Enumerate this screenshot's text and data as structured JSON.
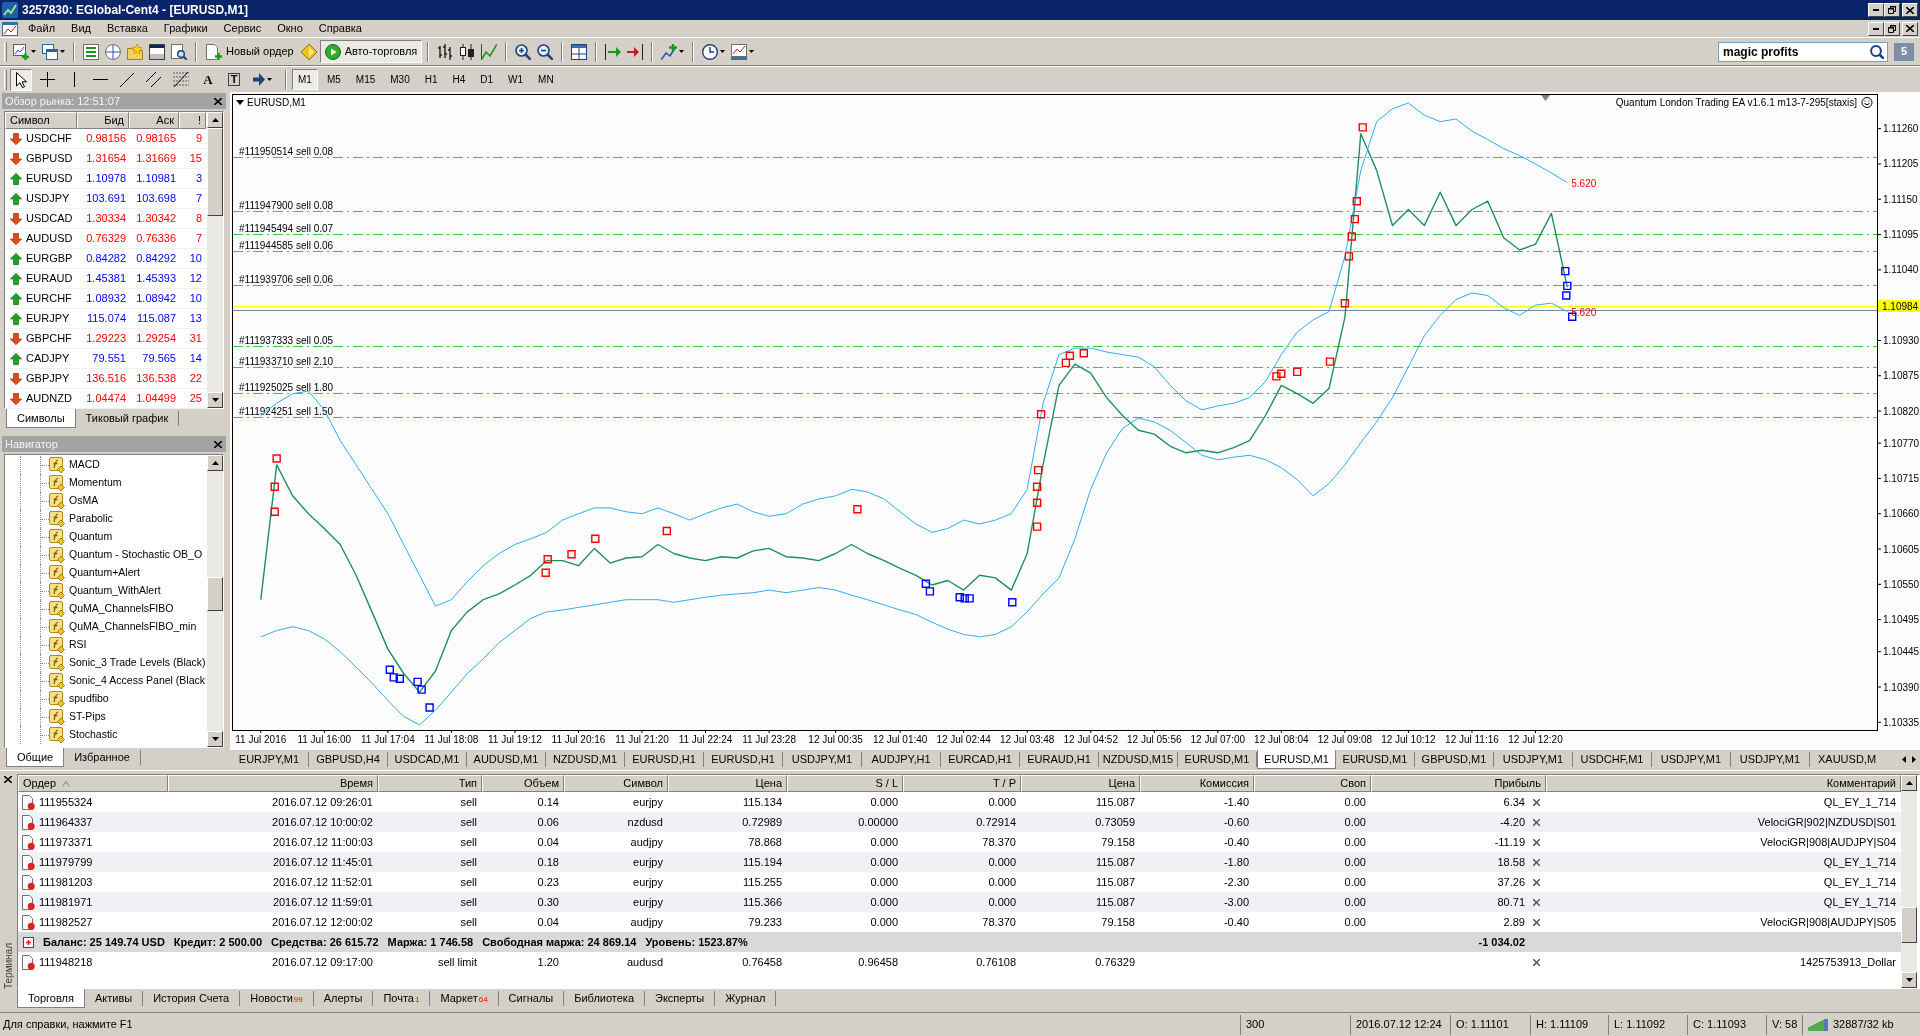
{
  "window": {
    "title": "3257830: EGlobal-Cent4 - [EURUSD,M1]"
  },
  "menu": [
    "Файл",
    "Вид",
    "Вставка",
    "Графики",
    "Сервис",
    "Окно",
    "Справка"
  ],
  "toolbar": {
    "new_order": "Новый ордер",
    "autotrading": {
      "label": "Авто-торговля",
      "on": true
    },
    "search": {
      "value": "magic profits"
    },
    "badge": "5"
  },
  "drawing_toolbar": {
    "tools": [
      {
        "kind": "cursor",
        "selected": true
      },
      {
        "kind": "crosshair",
        "selected": false
      },
      {
        "kind": "vertical-line",
        "selected": false
      },
      {
        "kind": "horizontal-line",
        "selected": false
      },
      {
        "kind": "trendline",
        "selected": false
      },
      {
        "kind": "channel",
        "selected": false
      },
      {
        "kind": "fibonacci",
        "selected": false
      },
      {
        "kind": "text",
        "glyph": "A",
        "selected": false
      },
      {
        "kind": "label",
        "glyph": "T",
        "selected": false
      },
      {
        "kind": "arrows",
        "selected": false
      }
    ],
    "periods": [
      {
        "label": "M1",
        "selected": true
      },
      {
        "label": "M5",
        "selected": false
      },
      {
        "label": "M15",
        "selected": false
      },
      {
        "label": "M30",
        "selected": false
      },
      {
        "label": "H1",
        "selected": false
      },
      {
        "label": "H4",
        "selected": false
      },
      {
        "label": "D1",
        "selected": false
      },
      {
        "label": "W1",
        "selected": false
      },
      {
        "label": "MN",
        "selected": false
      }
    ]
  },
  "market_watch": {
    "title": "Обзор рынка: 12:51:07",
    "columns": [
      "Символ",
      "Бид",
      "Аск",
      "!"
    ],
    "rows": [
      {
        "symbol": "USDCHF",
        "rising": false,
        "bid": "0.98156",
        "ask": "0.98165",
        "spread": "9"
      },
      {
        "symbol": "GBPUSD",
        "rising": false,
        "bid": "1.31654",
        "ask": "1.31669",
        "spread": "15"
      },
      {
        "symbol": "EURUSD",
        "rising": true,
        "bid": "1.10978",
        "ask": "1.10981",
        "spread": "3"
      },
      {
        "symbol": "USDJPY",
        "rising": true,
        "bid": "103.691",
        "ask": "103.698",
        "spread": "7"
      },
      {
        "symbol": "USDCAD",
        "rising": false,
        "bid": "1.30334",
        "ask": "1.30342",
        "spread": "8"
      },
      {
        "symbol": "AUDUSD",
        "rising": false,
        "bid": "0.76329",
        "ask": "0.76336",
        "spread": "7"
      },
      {
        "symbol": "EURGBP",
        "rising": true,
        "bid": "0.84282",
        "ask": "0.84292",
        "spread": "10"
      },
      {
        "symbol": "EURAUD",
        "rising": true,
        "bid": "1.45381",
        "ask": "1.45393",
        "spread": "12"
      },
      {
        "symbol": "EURCHF",
        "rising": true,
        "bid": "1.08932",
        "ask": "1.08942",
        "spread": "10"
      },
      {
        "symbol": "EURJPY",
        "rising": true,
        "bid": "115.074",
        "ask": "115.087",
        "spread": "13"
      },
      {
        "symbol": "GBPCHF",
        "rising": false,
        "bid": "1.29223",
        "ask": "1.29254",
        "spread": "31"
      },
      {
        "symbol": "CADJPY",
        "rising": true,
        "bid": "79.551",
        "ask": "79.565",
        "spread": "14"
      },
      {
        "symbol": "GBPJPY",
        "rising": false,
        "bid": "136.516",
        "ask": "136.538",
        "spread": "22"
      },
      {
        "symbol": "AUDNZD",
        "rising": false,
        "bid": "1.04474",
        "ask": "1.04499",
        "spread": "25"
      }
    ],
    "tabs": [
      {
        "label": "Символы",
        "selected": true
      },
      {
        "label": "Тиковый график",
        "selected": false
      }
    ]
  },
  "navigator": {
    "title": "Навигатор",
    "items": [
      "MACD",
      "Momentum",
      "OsMA",
      "Parabolic",
      "Quantum",
      "Quantum - Stochastic OB_O",
      "Quantum+Alert",
      "Quantum_WithAlert",
      "QuMA_ChannelsFIBO",
      "QuMA_ChannelsFIBO_min",
      "RSI",
      "Sonic_3 Trade Levels (Black)",
      "Sonic_4 Access Panel (Black",
      "spudfibo",
      "ST-Pips",
      "Stochastic"
    ],
    "tabs": [
      {
        "label": "Общие",
        "selected": true
      },
      {
        "label": "Избранное",
        "selected": false
      }
    ]
  },
  "chart": {
    "symbol_label": "EURUSD,M1",
    "expert_label": "Quantum London Trading EA v1.6.1 m13-7-295[staxis]",
    "chart_data": [
      {
        "type": "line",
        "x": [
          "2016-07-11T14:56",
          "2016-07-11T15:12",
          "2016-07-11T15:28",
          "2016-07-11T15:44",
          "2016-07-11T16:00",
          "2016-07-11T16:16",
          "2016-07-11T16:32",
          "2016-07-11T16:48",
          "2016-07-11T17:04",
          "2016-07-11T17:20",
          "2016-07-11T17:36",
          "2016-07-11T17:52",
          "2016-07-11T18:08",
          "2016-07-11T18:24",
          "2016-07-11T18:40",
          "2016-07-11T18:56",
          "2016-07-11T19:12",
          "2016-07-11T19:28",
          "2016-07-11T19:44",
          "2016-07-11T20:00",
          "2016-07-11T20:16",
          "2016-07-11T20:32",
          "2016-07-11T20:48",
          "2016-07-11T21:04",
          "2016-07-11T21:20",
          "2016-07-11T21:36",
          "2016-07-11T21:52",
          "2016-07-11T22:08",
          "2016-07-11T22:24",
          "2016-07-11T22:40",
          "2016-07-11T22:56",
          "2016-07-11T23:12",
          "2016-07-11T23:28",
          "2016-07-11T23:45",
          "2016-07-12T00:02",
          "2016-07-12T00:18",
          "2016-07-12T00:35",
          "2016-07-12T00:51",
          "2016-07-12T01:07",
          "2016-07-12T01:24",
          "2016-07-12T01:40",
          "2016-07-12T01:56",
          "2016-07-12T02:12",
          "2016-07-12T02:28",
          "2016-07-12T02:44",
          "2016-07-12T03:00",
          "2016-07-12T03:16",
          "2016-07-12T03:32",
          "2016-07-12T03:48",
          "2016-07-12T04:04",
          "2016-07-12T04:20",
          "2016-07-12T04:36",
          "2016-07-12T04:52",
          "2016-07-12T05:08",
          "2016-07-12T05:24",
          "2016-07-12T05:40",
          "2016-07-12T05:56",
          "2016-07-12T06:12",
          "2016-07-12T06:28",
          "2016-07-12T06:44",
          "2016-07-12T07:00",
          "2016-07-12T07:16",
          "2016-07-12T07:32",
          "2016-07-12T07:48",
          "2016-07-12T08:04",
          "2016-07-12T08:20",
          "2016-07-12T08:36",
          "2016-07-12T08:52",
          "2016-07-12T09:08",
          "2016-07-12T09:24",
          "2016-07-12T09:40",
          "2016-07-12T09:56",
          "2016-07-12T10:12",
          "2016-07-12T10:28",
          "2016-07-12T10:44",
          "2016-07-12T11:00",
          "2016-07-12T11:16",
          "2016-07-12T11:32",
          "2016-07-12T11:48",
          "2016-07-12T12:04",
          "2016-07-12T12:20",
          "2016-07-12T12:36",
          "2016-07-12T12:52"
        ],
        "xlim": [
          "2016-07-11T14:27",
          "2016-07-12T18:04"
        ],
        "ylim": [
          1.10323,
          1.11314
        ],
        "xticks": [
          {
            "value": "2016-07-11T16:00",
            "label": "11 Jul 16:00"
          },
          {
            "value": "2016-07-11T17:04",
            "label": "11 Jul 17:04"
          },
          {
            "value": "2016-07-11T18:08",
            "label": "11 Jul 18:08"
          },
          {
            "value": "2016-07-11T19:12",
            "label": "11 Jul 19:12"
          },
          {
            "value": "2016-07-11T20:16",
            "label": "11 Jul 20:16"
          },
          {
            "value": "2016-07-11T21:20",
            "label": "11 Jul 21:20"
          },
          {
            "value": "2016-07-11T22:24",
            "label": "11 Jul 22:24"
          },
          {
            "value": "2016-07-11T23:28",
            "label": "11 Jul 23:28"
          },
          {
            "value": "2016-07-12T00:35",
            "label": "12 Jul 00:35"
          },
          {
            "value": "2016-07-12T01:40",
            "label": "12 Jul 01:40"
          },
          {
            "value": "2016-07-12T02:44",
            "label": "12 Jul 02:44"
          },
          {
            "value": "2016-07-12T03:48",
            "label": "12 Jul 03:48"
          },
          {
            "value": "2016-07-12T04:52",
            "label": "12 Jul 04:52"
          },
          {
            "value": "2016-07-12T05:56",
            "label": "12 Jul 05:56"
          },
          {
            "value": "2016-07-12T07:00",
            "label": "12 Jul 07:00"
          },
          {
            "value": "2016-07-12T08:04",
            "label": "12 Jul 08:04"
          },
          {
            "value": "2016-07-12T09:08",
            "label": "12 Jul 09:08"
          },
          {
            "value": "2016-07-12T10:12",
            "label": "12 Jul 10:12"
          },
          {
            "value": "2016-07-12T11:16",
            "label": "12 Jul 11:16"
          },
          {
            "value": "2016-07-12T12:20",
            "label": "12 Jul 12:20"
          }
        ],
        "annotations": [
          "11 Jul 2016"
        ],
        "yticks": [
          {
            "value": 1.1126,
            "label": "1.11260"
          },
          {
            "value": 1.11205,
            "label": "1.11205"
          },
          {
            "value": 1.1115,
            "label": "1.11150"
          },
          {
            "value": 1.11095,
            "label": "1.11095"
          },
          {
            "value": 1.1104,
            "label": "1.11040"
          },
          {
            "value": 1.1093,
            "label": "1.10930"
          },
          {
            "value": 1.10875,
            "label": "1.10875"
          },
          {
            "value": 1.1082,
            "label": "1.10820"
          },
          {
            "value": 1.1077,
            "label": "1.10770"
          },
          {
            "value": 1.10715,
            "label": "1.10715"
          },
          {
            "value": 1.1066,
            "label": "1.10660"
          },
          {
            "value": 1.10605,
            "label": "1.10605"
          },
          {
            "value": 1.1055,
            "label": "1.10550"
          },
          {
            "value": 1.10495,
            "label": "1.10495"
          },
          {
            "value": 1.10445,
            "label": "1.10445"
          },
          {
            "value": 1.1039,
            "label": "1.10390"
          },
          {
            "value": 1.10335,
            "label": "1.10335"
          }
        ],
        "series": [
          {
            "color": "#1f8f5f",
            "values": [
              1.10526,
              1.10736,
              1.10688,
              1.1066,
              1.10637,
              1.10612,
              1.10564,
              1.10507,
              1.10449,
              1.10411,
              1.10382,
              1.10415,
              1.10478,
              1.10507,
              1.10526,
              1.10535,
              1.10549,
              1.10564,
              1.10587,
              1.10587,
              1.10579,
              1.10606,
              1.10583,
              1.10591,
              1.10593,
              1.10612,
              1.10598,
              1.10591,
              1.10587,
              1.10593,
              1.10591,
              1.10602,
              1.10606,
              1.10593,
              1.10591,
              1.10587,
              1.10598,
              1.10612,
              1.10598,
              1.10587,
              1.10575,
              1.10564,
              1.10549,
              1.10556,
              1.10541,
              1.10564,
              1.1056,
              1.10541,
              1.10598,
              1.10736,
              1.1086,
              1.10893,
              1.10879,
              1.10841,
              1.10813,
              1.1079,
              1.10784,
              1.10765,
              1.10755,
              1.10759,
              1.10755,
              1.10763,
              1.10774,
              1.10813,
              1.1086,
              1.10847,
              1.10832,
              1.10855,
              1.10966,
              1.11252,
              1.11195,
              1.11109,
              1.11134,
              1.11109,
              1.11161,
              1.11109,
              1.11134,
              1.11147,
              1.1109,
              1.11071,
              1.1108,
              1.11128,
              1.11013
            ]
          },
          {
            "name": "5.620",
            "color": "#30aef0",
            "values": [
              1.10813,
              1.10832,
              1.10847,
              1.10851,
              1.10822,
              1.10774,
              1.10736,
              1.10698,
              1.1066,
              1.10612,
              1.10564,
              1.10516,
              1.10526,
              1.10554,
              1.10579,
              1.10598,
              1.10612,
              1.10621,
              1.10631,
              1.1065,
              1.1066,
              1.10669,
              1.10669,
              1.10663,
              1.1066,
              1.10669,
              1.1066,
              1.1065,
              1.1066,
              1.10669,
              1.10675,
              1.10663,
              1.10656,
              1.1066,
              1.10675,
              1.10683,
              1.10688,
              1.10698,
              1.10694,
              1.10683,
              1.10663,
              1.10644,
              1.10631,
              1.10637,
              1.1065,
              1.10644,
              1.1065,
              1.1066,
              1.10698,
              1.10832,
              1.10908,
              1.10918,
              1.10918,
              1.10912,
              1.10908,
              1.10904,
              1.10889,
              1.1086,
              1.10836,
              1.10822,
              1.10828,
              1.10832,
              1.10841,
              1.10866,
              1.10908,
              1.10943,
              1.10962,
              1.10975,
              1.11061,
              1.11195,
              1.11271,
              1.11291,
              1.113,
              1.11281,
              1.11271,
              1.11275,
              1.11256,
              1.11243,
              1.11229,
              1.11218,
              1.11205,
              1.11191,
              1.11176
            ]
          },
          {
            "name": "5.620",
            "color": "#30aef0",
            "values": [
              1.10468,
              1.10478,
              1.10484,
              1.10478,
              1.10465,
              1.10445,
              1.10421,
              1.10396,
              1.10369,
              1.10344,
              1.10331,
              1.10354,
              1.10382,
              1.10411,
              1.10434,
              1.10459,
              1.10478,
              1.10497,
              1.10507,
              1.1051,
              1.10514,
              1.10518,
              1.10522,
              1.10526,
              1.10526,
              1.10526,
              1.10522,
              1.10526,
              1.1053,
              1.10533,
              1.10535,
              1.10537,
              1.10541,
              1.10537,
              1.10541,
              1.10545,
              1.10541,
              1.10533,
              1.10526,
              1.10518,
              1.1051,
              1.10503,
              1.10491,
              1.1048,
              1.10472,
              1.10468,
              1.10472,
              1.10484,
              1.10507,
              1.10535,
              1.1056,
              1.10621,
              1.10698,
              1.10755,
              1.10793,
              1.10809,
              1.10803,
              1.1079,
              1.10771,
              1.10751,
              1.10744,
              1.10748,
              1.10751,
              1.10744,
              1.10732,
              1.10713,
              1.10688,
              1.10707,
              1.10736,
              1.10771,
              1.10803,
              1.10841,
              1.10889,
              1.10937,
              1.10969,
              1.10994,
              1.11004,
              1.11,
              1.10981,
              1.10969,
              1.10985,
              1.10988,
              1.10975
            ]
          },
          {
            "type": "scatter",
            "marker": "square",
            "color": "#ff0000",
            "x": [
              "2016-07-11T15:12",
              "2016-07-11T15:10",
              "2016-07-11T15:10",
              "2016-07-11T19:45",
              "2016-07-11T19:43",
              "2016-07-11T20:09",
              "2016-07-11T20:33",
              "2016-07-11T21:45",
              "2016-07-12T00:57",
              "2016-07-12T03:58",
              "2016-07-12T03:58",
              "2016-07-12T03:58",
              "2016-07-12T03:59",
              "2016-07-12T04:02",
              "2016-07-12T04:27",
              "2016-07-12T04:31",
              "2016-07-12T04:45",
              "2016-07-12T07:59",
              "2016-07-12T08:04",
              "2016-07-12T08:20",
              "2016-07-12T08:53",
              "2016-07-12T09:08",
              "2016-07-12T09:12",
              "2016-07-12T09:15",
              "2016-07-12T09:18",
              "2016-07-12T09:20",
              "2016-07-12T09:26"
            ],
            "values": [
              1.10746,
              1.10702,
              1.10663,
              1.10589,
              1.10568,
              1.10597,
              1.10621,
              1.10633,
              1.10667,
              1.1064,
              1.10677,
              1.10702,
              1.10728,
              1.10815,
              1.10895,
              1.10906,
              1.1091,
              1.10874,
              1.10878,
              1.10881,
              1.10897,
              1.10988,
              1.11061,
              1.11092,
              1.11119,
              1.11147,
              1.11262
            ]
          },
          {
            "type": "scatter",
            "marker": "square",
            "color": "#0000ff",
            "x": [
              "2016-07-11T17:06",
              "2016-07-11T17:10",
              "2016-07-11T17:16",
              "2016-07-11T17:34",
              "2016-07-11T17:38",
              "2016-07-11T17:46",
              "2016-07-12T02:06",
              "2016-07-12T02:10",
              "2016-07-12T02:40",
              "2016-07-12T02:45",
              "2016-07-12T02:50",
              "2016-07-12T03:33",
              "2016-07-12T12:50",
              "2016-07-12T12:51",
              "2016-07-12T12:52",
              "2016-07-12T12:57"
            ],
            "values": [
              1.10417,
              1.10405,
              1.10403,
              1.10398,
              1.10386,
              1.10358,
              1.10551,
              1.10539,
              1.1053,
              1.10528,
              1.10528,
              1.10522,
              1.11038,
              1.11,
              1.11015,
              1.10967
            ]
          }
        ],
        "ref_lines": [
          {
            "axis": "y",
            "value": 1.11216,
            "label": "#111950514 sell 0.08",
            "color": "#32cd32",
            "line_style": "dashdot"
          },
          {
            "axis": "y",
            "value": 1.11132,
            "label": "#111947900 sell 0.08",
            "color": "#32cd32",
            "line_style": "dashdot"
          },
          {
            "axis": "y",
            "value": 1.11096,
            "label": "#111945494 sell 0.07",
            "color": "#32cd32",
            "line_style": "dashdot"
          },
          {
            "axis": "y",
            "value": 1.1107,
            "label": "#111944585 sell 0.06",
            "color": "#32cd32",
            "line_style": "dashdot"
          },
          {
            "axis": "y",
            "value": 1.11016,
            "label": "#111939706 sell 0.06",
            "color": "#32cd32",
            "line_style": "dashdot"
          },
          {
            "axis": "y",
            "value": 1.10984,
            "label": "1.10984",
            "color": "#ffff00",
            "line_style": "solid"
          },
          {
            "axis": "y",
            "value": 1.10978,
            "color": "#778899",
            "line_style": "solid"
          },
          {
            "axis": "y",
            "value": 1.10921,
            "label": "#111937333 sell 0.05",
            "color": "#32cd32",
            "line_style": "dashdot"
          },
          {
            "axis": "y",
            "value": 1.10889,
            "label": "#111933710 sell 2.10",
            "color": "#32cd32",
            "line_style": "dashdot"
          },
          {
            "axis": "y",
            "value": 1.10848,
            "label": "#111925025 sell 1.80",
            "color": "#32cd32",
            "line_style": "dashdot"
          },
          {
            "axis": "y",
            "value": 1.10811,
            "label": "#111924251 sell 1.50",
            "color": "#32cd32",
            "line_style": "dashdot"
          }
        ]
      }
    ]
  },
  "chart_tabs": [
    {
      "label": "EURJPY,M1",
      "selected": false
    },
    {
      "label": "GBPUSD,H4",
      "selected": false
    },
    {
      "label": "USDCAD,M1",
      "selected": false
    },
    {
      "label": "AUDUSD,M1",
      "selected": false
    },
    {
      "label": "NZDUSD,M1",
      "selected": false
    },
    {
      "label": "EURUSD,H1",
      "selected": false
    },
    {
      "label": "EURUSD,H1",
      "selected": false
    },
    {
      "label": "USDJPY,M1",
      "selected": false
    },
    {
      "label": "AUDJPY,H1",
      "selected": false
    },
    {
      "label": "EURCAD,H1",
      "selected": false
    },
    {
      "label": "EURAUD,H1",
      "selected": false
    },
    {
      "label": "NZDUSD,M15",
      "selected": false
    },
    {
      "label": "EURUSD,M1",
      "selected": false
    },
    {
      "label": "EURUSD,M1",
      "selected": true
    },
    {
      "label": "EURUSD,M1",
      "selected": false
    },
    {
      "label": "GBPUSD,M1",
      "selected": false
    },
    {
      "label": "USDJPY,M1",
      "selected": false
    },
    {
      "label": "USDCHF,M1",
      "selected": false
    },
    {
      "label": "USDJPY,M1",
      "selected": false
    },
    {
      "label": "USDJPY,M1",
      "selected": false
    },
    {
      "label": "XAUUSD,M",
      "selected": false
    }
  ],
  "terminal": {
    "side_label": "Терминал",
    "columns": [
      {
        "label": "Ордер",
        "sorted": true
      },
      {
        "label": "Время",
        "sorted": false
      },
      {
        "label": "Тип",
        "sorted": false
      },
      {
        "label": "Объем",
        "sorted": false
      },
      {
        "label": "Символ",
        "sorted": false
      },
      {
        "label": "Цена",
        "sorted": false
      },
      {
        "label": "S / L",
        "sorted": false
      },
      {
        "label": "T / P",
        "sorted": false
      },
      {
        "label": "Цена",
        "sorted": false
      },
      {
        "label": "Комиссия",
        "sorted": false
      },
      {
        "label": "Своп",
        "sorted": false
      },
      {
        "label": "Прибыль",
        "sorted": false
      },
      {
        "label": "Комментарий",
        "sorted": false
      }
    ],
    "orders": [
      {
        "order": "111955324",
        "time": "2016.07.12 09:26:01",
        "type": "sell",
        "volume": "0.14",
        "symbol": "eurjpy",
        "price": "115.134",
        "sl": "0.000",
        "tp": "0.000",
        "current_price": "115.087",
        "commission": "-1.40",
        "swap": "0.00",
        "profit": "6.34",
        "comment": "QL_EY_1_714"
      },
      {
        "order": "111964337",
        "time": "2016.07.12 10:00:02",
        "type": "sell",
        "volume": "0.06",
        "symbol": "nzdusd",
        "price": "0.72989",
        "sl": "0.00000",
        "tp": "0.72914",
        "current_price": "0.73059",
        "commission": "-0.60",
        "swap": "0.00",
        "profit": "-4.20",
        "comment": "VelociGR|902|NZDUSD|S01"
      },
      {
        "order": "111973371",
        "time": "2016.07.12 11:00:03",
        "type": "sell",
        "volume": "0.04",
        "symbol": "audjpy",
        "price": "78.868",
        "sl": "0.000",
        "tp": "78.370",
        "current_price": "79.158",
        "commission": "-0.40",
        "swap": "0.00",
        "profit": "-11.19",
        "comment": "VelociGR|908|AUDJPY|S04"
      },
      {
        "order": "111979799",
        "time": "2016.07.12 11:45:01",
        "type": "sell",
        "volume": "0.18",
        "symbol": "eurjpy",
        "price": "115.194",
        "sl": "0.000",
        "tp": "0.000",
        "current_price": "115.087",
        "commission": "-1.80",
        "swap": "0.00",
        "profit": "18.58",
        "comment": "QL_EY_1_714"
      },
      {
        "order": "111981203",
        "time": "2016.07.12 11:52:01",
        "type": "sell",
        "volume": "0.23",
        "symbol": "eurjpy",
        "price": "115.255",
        "sl": "0.000",
        "tp": "0.000",
        "current_price": "115.087",
        "commission": "-2.30",
        "swap": "0.00",
        "profit": "37.26",
        "comment": "QL_EY_1_714"
      },
      {
        "order": "111981971",
        "time": "2016.07.12 11:59:01",
        "type": "sell",
        "volume": "0.30",
        "symbol": "eurjpy",
        "price": "115.366",
        "sl": "0.000",
        "tp": "0.000",
        "current_price": "115.087",
        "commission": "-3.00",
        "swap": "0.00",
        "profit": "80.71",
        "comment": "QL_EY_1_714"
      },
      {
        "order": "111982527",
        "time": "2016.07.12 12:00:02",
        "type": "sell",
        "volume": "0.04",
        "symbol": "audjpy",
        "price": "79.233",
        "sl": "0.000",
        "tp": "78.370",
        "current_price": "79.158",
        "commission": "-0.40",
        "swap": "0.00",
        "profit": "2.89",
        "comment": "VelociGR|908|AUDJPY|S05"
      }
    ],
    "summary": {
      "items": [
        "Баланс: 25 149.74 USD",
        "Кредит: 2 500.00",
        "Средства: 26 615.72",
        "Маржа: 1 746.58",
        "Свободная маржа: 24 869.14",
        "Уровень: 1523.87%"
      ],
      "profit": "-1 034.02"
    },
    "pending_orders": [
      {
        "order": "111948218",
        "time": "2016.07.12 09:17:00",
        "type": "sell limit",
        "volume": "1.20",
        "symbol": "audusd",
        "price": "0.76458",
        "sl": "0.96458",
        "tp": "0.76108",
        "current_price": "0.76329",
        "comment": "1425753913_Dollar"
      }
    ],
    "tabs": [
      {
        "label": "Торговля",
        "selected": true
      },
      {
        "label": "Активы",
        "selected": false
      },
      {
        "label": "История Счета",
        "selected": false
      },
      {
        "label": "Новости",
        "count": "99",
        "selected": false
      },
      {
        "label": "Алерты",
        "selected": false
      },
      {
        "label": "Почта",
        "count": "1",
        "selected": false
      },
      {
        "label": "Маркет",
        "count": "64",
        "selected": false
      },
      {
        "label": "Сигналы",
        "selected": false
      },
      {
        "label": "Библиотека",
        "selected": false
      },
      {
        "label": "Эксперты",
        "selected": false
      },
      {
        "label": "Журнал",
        "selected": false
      }
    ]
  },
  "status_bar": {
    "help": "Для справки, нажмите F1",
    "bars": "300",
    "time": "2016.07.12 12:24",
    "open": "O: 1.11101",
    "high": "H: 1.11109",
    "low": "L: 1.11092",
    "close": "C: 1.11093",
    "volume": "V: 58",
    "traffic": "32887/32 kb"
  }
}
